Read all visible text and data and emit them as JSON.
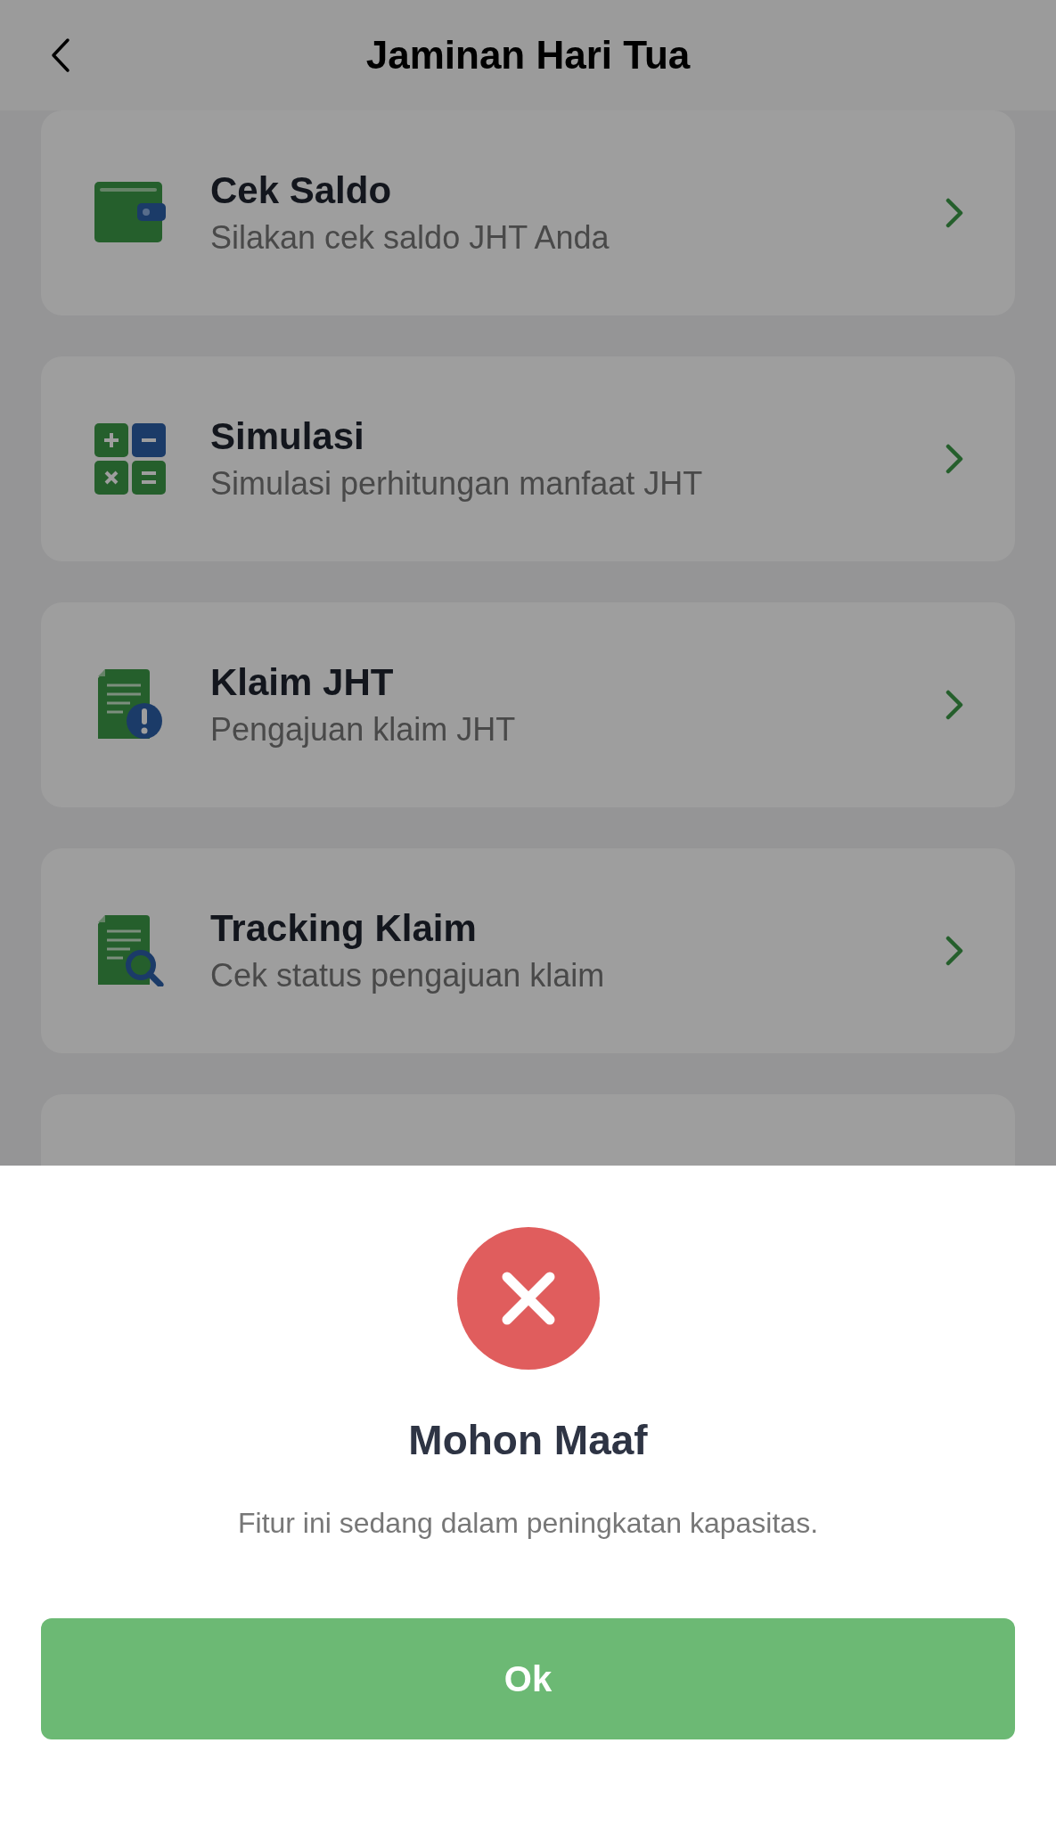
{
  "header": {
    "title": "Jaminan Hari Tua"
  },
  "menu": [
    {
      "kind": "wallet",
      "title": "Cek Saldo",
      "subtitle": "Silakan cek saldo JHT Anda"
    },
    {
      "kind": "calculator",
      "title": "Simulasi",
      "subtitle": "Simulasi perhitungan manfaat JHT"
    },
    {
      "kind": "document-alert",
      "title": "Klaim JHT",
      "subtitle": "Pengajuan klaim JHT"
    },
    {
      "kind": "document-search",
      "title": "Tracking Klaim",
      "subtitle": "Cek status pengajuan klaim"
    }
  ],
  "dialog": {
    "title": "Mohon Maaf",
    "message": "Fitur ini sedang dalam peningkatan kapasitas.",
    "button": "Ok"
  }
}
